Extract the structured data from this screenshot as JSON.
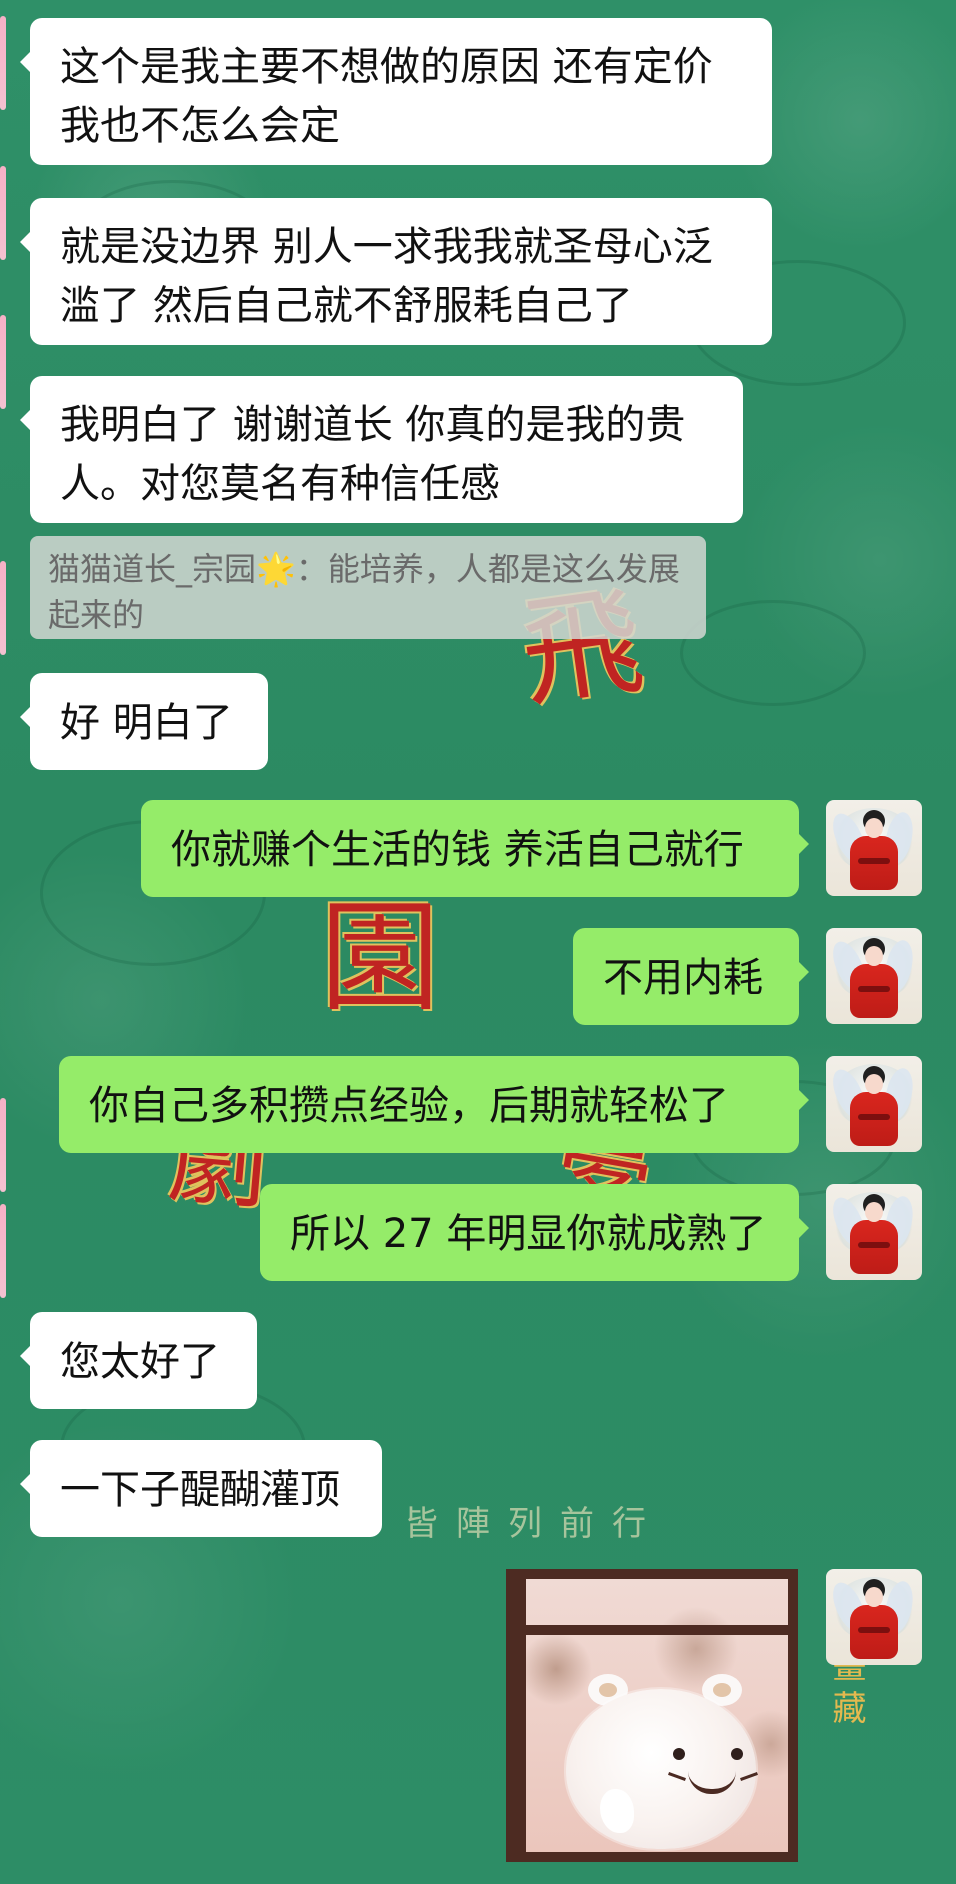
{
  "chat": {
    "messages": [
      {
        "id": "m1",
        "side": "left",
        "text": "这个是我主要不想做的原因 还有定价我也不怎么会定"
      },
      {
        "id": "m2",
        "side": "left",
        "text": "就是没边界 别人一求我我就圣母心泛滥了 然后自己就不舒服耗自己了"
      },
      {
        "id": "m3",
        "side": "left",
        "text": "我明白了 谢谢道长 你真的是我的贵人。对您莫名有种信任感"
      },
      {
        "id": "m4",
        "side": "left",
        "text": "好 明白了"
      },
      {
        "id": "m5",
        "side": "right",
        "text": "你就赚个生活的钱 养活自己就行"
      },
      {
        "id": "m6",
        "side": "right",
        "text": "不用内耗"
      },
      {
        "id": "m7",
        "side": "right",
        "text": "你自己多积攒点经验，后期就轻松了"
      },
      {
        "id": "m8",
        "side": "right",
        "text": "所以 27 年明显你就成熟了"
      },
      {
        "id": "m9",
        "side": "left",
        "text": "您太好了"
      },
      {
        "id": "m10",
        "side": "left",
        "text": "一下子醍醐灌顶"
      }
    ],
    "quote": {
      "text": "猫猫道长_宗园🌟：能培养，人都是这么发展起来的"
    }
  },
  "background": {
    "characters": [
      "飛",
      "園",
      "劇",
      "夢"
    ],
    "tagline": "皆陣列前行",
    "corner_text": "畫藏"
  },
  "colors": {
    "background": "#2f8c65",
    "left_bubble": "#ffffff",
    "right_bubble": "#95ec69",
    "quote_bg": "#d3d6d3"
  }
}
